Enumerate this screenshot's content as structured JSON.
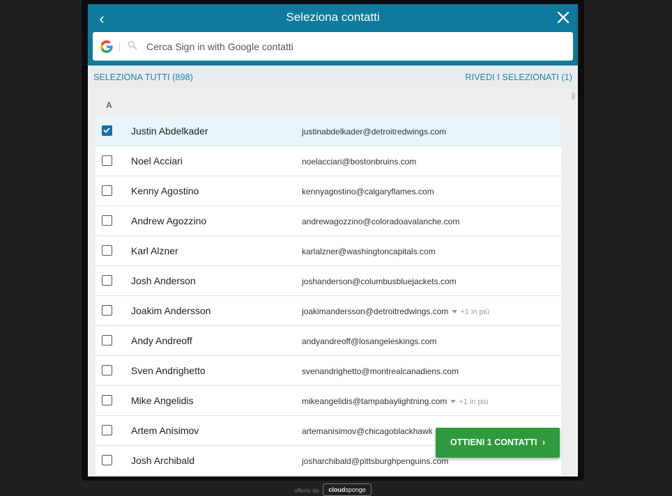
{
  "header": {
    "title": "Seleziona contatti",
    "back_label": "‹"
  },
  "search": {
    "placeholder": "Cerca Sign in with Google contatti"
  },
  "toolbar": {
    "select_all": "SELEZIONA TUTTI (898)",
    "review_selected": "RIVEDI I SELEZIONATI (1)"
  },
  "section_letter": "A",
  "contacts": [
    {
      "name": "Justin Abdelkader",
      "email": "justinabdelkader@detroitredwings.com",
      "checked": true,
      "more": ""
    },
    {
      "name": "Noel Acciari",
      "email": "noelacciari@bostonbruins.com",
      "checked": false,
      "more": ""
    },
    {
      "name": "Kenny Agostino",
      "email": "kennyagostino@calgaryflames.com",
      "checked": false,
      "more": ""
    },
    {
      "name": "Andrew Agozzino",
      "email": "andrewagozzino@coloradoavalanche.com",
      "checked": false,
      "more": ""
    },
    {
      "name": "Karl Alzner",
      "email": "karlalzner@washingtoncapitals.com",
      "checked": false,
      "more": ""
    },
    {
      "name": "Josh Anderson",
      "email": "joshanderson@columbusbluejackets.com",
      "checked": false,
      "more": ""
    },
    {
      "name": "Joakim Andersson",
      "email": "joakimandersson@detroitredwings.com",
      "checked": false,
      "more": "+1 in più"
    },
    {
      "name": "Andy Andreoff",
      "email": "andyandreoff@losangeleskings.com",
      "checked": false,
      "more": ""
    },
    {
      "name": "Sven Andrighetto",
      "email": "svenandrighetto@montrealcanadiens.com",
      "checked": false,
      "more": ""
    },
    {
      "name": "Mike Angelidis",
      "email": "mikeangelidis@tampabaylightning.com",
      "checked": false,
      "more": "+1 in più"
    },
    {
      "name": "Artem Anisimov",
      "email": "artemanisimov@chicagoblackhawk",
      "checked": false,
      "more": ""
    },
    {
      "name": "Josh Archibald",
      "email": "josharchibald@pittsburghpenguins.com",
      "checked": false,
      "more": ""
    }
  ],
  "cta": {
    "label": "OTTIENI 1 CONTATTI",
    "chevron": "›"
  },
  "footer": {
    "offered_by": "offerto da",
    "brand_bold": "cloud",
    "brand_rest": "sponge"
  },
  "colors": {
    "header": "#0f7a9b",
    "accent": "#1a86a6",
    "cta": "#2f9a3c",
    "checkbox": "#1a6fa8"
  },
  "icons": {
    "back": "chevron-left-icon",
    "close": "close-icon",
    "google": "google-g-icon",
    "search": "search-icon",
    "check": "checkmark-icon",
    "expand": "caret-down-icon",
    "cta": "chevron-right-icon"
  }
}
